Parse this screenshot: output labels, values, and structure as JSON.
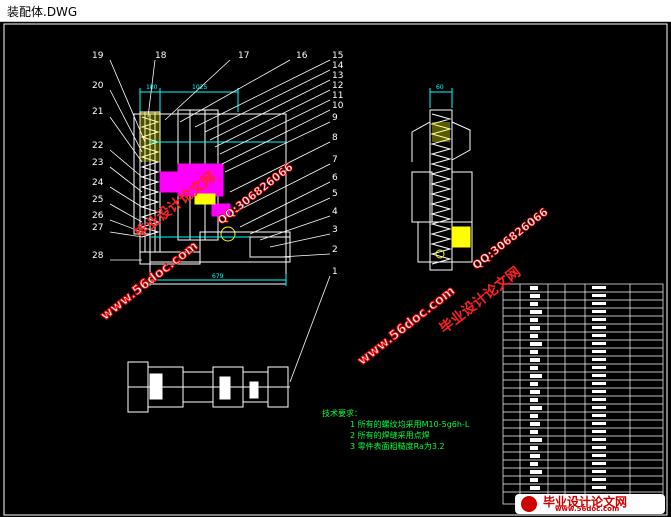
{
  "window": {
    "title": "装配体.DWG"
  },
  "balloons_left": [
    "19",
    "18",
    "17",
    "16",
    "15",
    "14",
    "13",
    "12",
    "11",
    "10",
    "9",
    "8",
    "7",
    "6",
    "5",
    "4",
    "3",
    "2",
    "1",
    "20",
    "21",
    "22",
    "23",
    "24",
    "25",
    "26",
    "27",
    "28"
  ],
  "dimensions": {
    "top_a": "180",
    "top_b": "1025",
    "bottom": "679",
    "side": "60"
  },
  "tech_requirements": {
    "heading": "技术要求：",
    "items": [
      "1  所有的螺纹均采用M10-5g6h-L",
      "2  所有的焊缝采用点焊",
      "3  零件表面粗糙度Ra为3.2"
    ]
  },
  "watermarks": {
    "site": "www.56doc.com",
    "name": "毕业设计论文网",
    "qq": "QQ:306826066"
  },
  "logo": {
    "text": "毕业设计论文网",
    "url": "www.56doc.com"
  },
  "colors": {
    "background": "#000000",
    "lines": "#ffffff",
    "cyan": "#00ffff",
    "magenta": "#ff00ff",
    "yellow": "#ffff00",
    "green": "#00ff40",
    "watermark": "#ff0000"
  }
}
